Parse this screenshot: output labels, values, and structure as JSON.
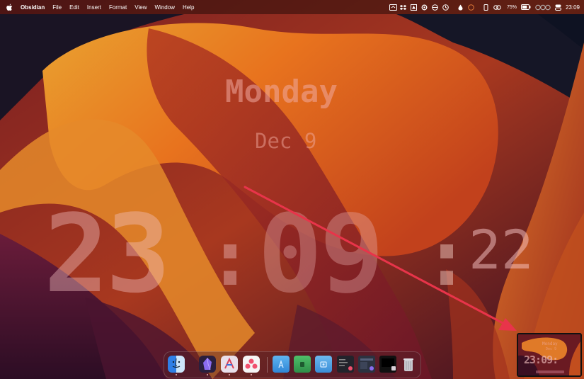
{
  "menubar": {
    "app_name": "Obsidian",
    "menus": [
      "File",
      "Edit",
      "Insert",
      "Format",
      "View",
      "Window",
      "Help"
    ],
    "battery_percent": "75%",
    "time": "23:09"
  },
  "clock": {
    "day": "Monday",
    "date": "Dec 9",
    "hours": "23",
    "separator": ":",
    "minutes": "09",
    "seconds": "22"
  },
  "thumbnail": {
    "day": "Monday",
    "date": "Dec 9",
    "time": "23:09:"
  },
  "dock": {
    "apps": [
      {
        "name": "finder-icon",
        "running": true
      },
      {
        "name": "obsidian-icon",
        "running": true
      },
      {
        "name": "notes-app-icon",
        "running": true
      },
      {
        "name": "asana-icon",
        "running": true
      },
      {
        "name": "applications-folder-icon",
        "running": false
      },
      {
        "name": "green-folder-icon",
        "running": false
      },
      {
        "name": "screenshots-folder-icon",
        "running": false
      },
      {
        "name": "recent-window-1-icon",
        "running": false
      },
      {
        "name": "recent-window-2-icon",
        "running": false
      },
      {
        "name": "recent-window-3-icon",
        "running": false
      },
      {
        "name": "trash-icon",
        "running": false
      }
    ]
  },
  "colors": {
    "arrow": "#e8344a",
    "wallpaper_orange": "#e8731e",
    "wallpaper_dark": "#12131f"
  }
}
